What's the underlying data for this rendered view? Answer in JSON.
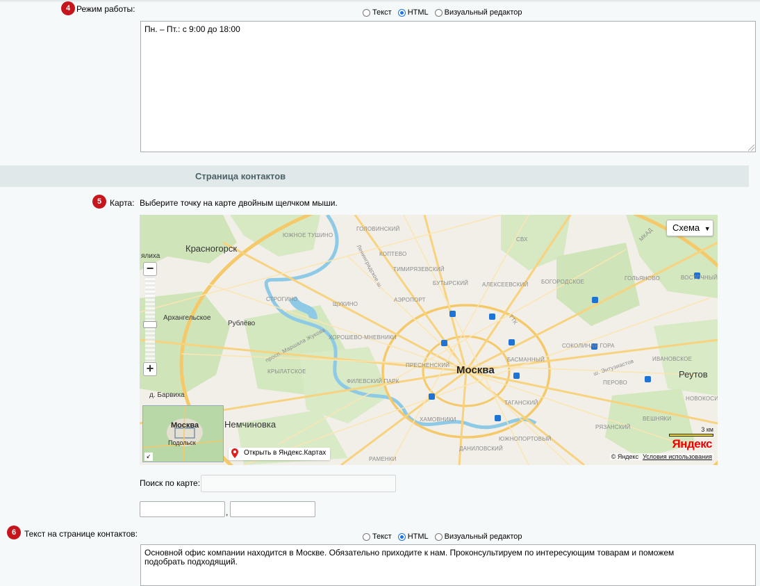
{
  "colors": {
    "badge": "#c5161d",
    "accent": "#1a73e8",
    "section_bg": "#e0e8ea"
  },
  "work_hours": {
    "badge": "4",
    "label": "Режим работы:",
    "modes": [
      "Текст",
      "HTML",
      "Визуальный редактор"
    ],
    "selected_mode": "HTML",
    "value": "Пн. – Пт.: с 9:00 до 18:00"
  },
  "section": {
    "title": "Страница контактов"
  },
  "map_field": {
    "badge": "5",
    "label": "Карта:",
    "hint": "Выберите точку на карте двойным щелчком мыши.",
    "type_button": "Схема",
    "open_link": "Открыть в Яндекс.Картах",
    "scale": "3 км",
    "logo_text": "Яндекс",
    "copyright": "© Яндекс",
    "terms": "Условия использования",
    "minimap": {
      "city": "Москва",
      "town": "Подольск"
    },
    "places": {
      "krasnogorsk": "Красногорск",
      "moscow": "Москва",
      "reutov": "Реутов",
      "arkhangelskoe": "Архангельское",
      "rublevo": "Рублёво",
      "barvikha": "д. Барвиха",
      "nemchinovka": "Немчиновка",
      "alashikha_part": "ялиха",
      "golovinsky": "ГОЛОВИНСКИЙ",
      "koptevo": "КОПТЕВО",
      "timiryazevsky": "ТИМИРЯЗЕВСКИЙ",
      "butyrsky": "БУТЫРСКИЙ",
      "alekseevsky": "АЛЕКСЕЕВСКИЙ",
      "bogorodskoe": "БОГОРОДСКОЕ",
      "golyanovo": "ГОЛЬЯНОВО",
      "vostochny": "ВОСТОЧНЫЙ",
      "yuzhnoe_tushino": "ЮЖНОЕ ТУШИНО",
      "strogino": "СТРОГИНО",
      "shchukino": "ЩУКИНО",
      "aeroport": "АЭРОПОРТ",
      "khoroshevo": "ХОРОШЕВО-МНЕВНИКИ",
      "krylatskoe": "КРЫЛАТСКОЕ",
      "presnensky": "ПРЕСНЕНСКИЙ",
      "basmanny": "БАСМАННЫЙ",
      "sokolinaya": "СОКОЛИНАЯ ГОРА",
      "ivanovskoe": "ИВАНОВСКОЕ",
      "perovo": "ПЕРОВО",
      "filevsky": "ФИЛЕВСКИЙ ПАРК",
      "khamovniki": "ХАМОВНИКИ",
      "tagansky": "ТАГАНСКИЙ",
      "novokosino": "НОВОКОСИНО",
      "ryazansky": "РЯЗАНСКИЙ",
      "veshnyaki": "ВЕШНЯКИ",
      "danilovsky": "ДАНИЛОВСКИЙ",
      "yuzhnoportovy": "ЮЖНОПОРТОВЫЙ",
      "ramenki": "РАМЕНКИ",
      "mkad": "МКАД",
      "svh": "СВХ",
      "ttk": "ТТК",
      "entuziastov": "ш. Энтузиастов",
      "marshala_zhukova": "просп. Маршала Жукова",
      "leningradskoe": "Ленинградское ш."
    }
  },
  "map_search": {
    "label": "Поиск по карте:",
    "value": "",
    "coord1": "",
    "coord2": "",
    "separator": ","
  },
  "contacts_text": {
    "badge": "6",
    "label": "Текст на странице контактов:",
    "modes": [
      "Текст",
      "HTML",
      "Визуальный редактор"
    ],
    "selected_mode": "HTML",
    "value": "Основной офис компании находится в Москве. Обязательно приходите к нам. Проконсультируем по интересующим товарам и поможем подобрать подходящий."
  }
}
